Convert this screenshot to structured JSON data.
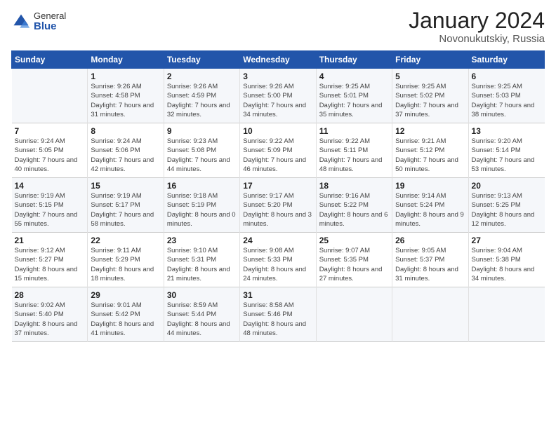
{
  "header": {
    "logo_general": "General",
    "logo_blue": "Blue",
    "month_year": "January 2024",
    "location": "Novonukutskiy, Russia"
  },
  "days_of_week": [
    "Sunday",
    "Monday",
    "Tuesday",
    "Wednesday",
    "Thursday",
    "Friday",
    "Saturday"
  ],
  "weeks": [
    [
      {
        "day": "",
        "sunrise": "",
        "sunset": "",
        "daylight": ""
      },
      {
        "day": "1",
        "sunrise": "Sunrise: 9:26 AM",
        "sunset": "Sunset: 4:58 PM",
        "daylight": "Daylight: 7 hours and 31 minutes."
      },
      {
        "day": "2",
        "sunrise": "Sunrise: 9:26 AM",
        "sunset": "Sunset: 4:59 PM",
        "daylight": "Daylight: 7 hours and 32 minutes."
      },
      {
        "day": "3",
        "sunrise": "Sunrise: 9:26 AM",
        "sunset": "Sunset: 5:00 PM",
        "daylight": "Daylight: 7 hours and 34 minutes."
      },
      {
        "day": "4",
        "sunrise": "Sunrise: 9:25 AM",
        "sunset": "Sunset: 5:01 PM",
        "daylight": "Daylight: 7 hours and 35 minutes."
      },
      {
        "day": "5",
        "sunrise": "Sunrise: 9:25 AM",
        "sunset": "Sunset: 5:02 PM",
        "daylight": "Daylight: 7 hours and 37 minutes."
      },
      {
        "day": "6",
        "sunrise": "Sunrise: 9:25 AM",
        "sunset": "Sunset: 5:03 PM",
        "daylight": "Daylight: 7 hours and 38 minutes."
      }
    ],
    [
      {
        "day": "7",
        "sunrise": "Sunrise: 9:24 AM",
        "sunset": "Sunset: 5:05 PM",
        "daylight": "Daylight: 7 hours and 40 minutes."
      },
      {
        "day": "8",
        "sunrise": "Sunrise: 9:24 AM",
        "sunset": "Sunset: 5:06 PM",
        "daylight": "Daylight: 7 hours and 42 minutes."
      },
      {
        "day": "9",
        "sunrise": "Sunrise: 9:23 AM",
        "sunset": "Sunset: 5:08 PM",
        "daylight": "Daylight: 7 hours and 44 minutes."
      },
      {
        "day": "10",
        "sunrise": "Sunrise: 9:22 AM",
        "sunset": "Sunset: 5:09 PM",
        "daylight": "Daylight: 7 hours and 46 minutes."
      },
      {
        "day": "11",
        "sunrise": "Sunrise: 9:22 AM",
        "sunset": "Sunset: 5:11 PM",
        "daylight": "Daylight: 7 hours and 48 minutes."
      },
      {
        "day": "12",
        "sunrise": "Sunrise: 9:21 AM",
        "sunset": "Sunset: 5:12 PM",
        "daylight": "Daylight: 7 hours and 50 minutes."
      },
      {
        "day": "13",
        "sunrise": "Sunrise: 9:20 AM",
        "sunset": "Sunset: 5:14 PM",
        "daylight": "Daylight: 7 hours and 53 minutes."
      }
    ],
    [
      {
        "day": "14",
        "sunrise": "Sunrise: 9:19 AM",
        "sunset": "Sunset: 5:15 PM",
        "daylight": "Daylight: 7 hours and 55 minutes."
      },
      {
        "day": "15",
        "sunrise": "Sunrise: 9:19 AM",
        "sunset": "Sunset: 5:17 PM",
        "daylight": "Daylight: 7 hours and 58 minutes."
      },
      {
        "day": "16",
        "sunrise": "Sunrise: 9:18 AM",
        "sunset": "Sunset: 5:19 PM",
        "daylight": "Daylight: 8 hours and 0 minutes."
      },
      {
        "day": "17",
        "sunrise": "Sunrise: 9:17 AM",
        "sunset": "Sunset: 5:20 PM",
        "daylight": "Daylight: 8 hours and 3 minutes."
      },
      {
        "day": "18",
        "sunrise": "Sunrise: 9:16 AM",
        "sunset": "Sunset: 5:22 PM",
        "daylight": "Daylight: 8 hours and 6 minutes."
      },
      {
        "day": "19",
        "sunrise": "Sunrise: 9:14 AM",
        "sunset": "Sunset: 5:24 PM",
        "daylight": "Daylight: 8 hours and 9 minutes."
      },
      {
        "day": "20",
        "sunrise": "Sunrise: 9:13 AM",
        "sunset": "Sunset: 5:25 PM",
        "daylight": "Daylight: 8 hours and 12 minutes."
      }
    ],
    [
      {
        "day": "21",
        "sunrise": "Sunrise: 9:12 AM",
        "sunset": "Sunset: 5:27 PM",
        "daylight": "Daylight: 8 hours and 15 minutes."
      },
      {
        "day": "22",
        "sunrise": "Sunrise: 9:11 AM",
        "sunset": "Sunset: 5:29 PM",
        "daylight": "Daylight: 8 hours and 18 minutes."
      },
      {
        "day": "23",
        "sunrise": "Sunrise: 9:10 AM",
        "sunset": "Sunset: 5:31 PM",
        "daylight": "Daylight: 8 hours and 21 minutes."
      },
      {
        "day": "24",
        "sunrise": "Sunrise: 9:08 AM",
        "sunset": "Sunset: 5:33 PM",
        "daylight": "Daylight: 8 hours and 24 minutes."
      },
      {
        "day": "25",
        "sunrise": "Sunrise: 9:07 AM",
        "sunset": "Sunset: 5:35 PM",
        "daylight": "Daylight: 8 hours and 27 minutes."
      },
      {
        "day": "26",
        "sunrise": "Sunrise: 9:05 AM",
        "sunset": "Sunset: 5:37 PM",
        "daylight": "Daylight: 8 hours and 31 minutes."
      },
      {
        "day": "27",
        "sunrise": "Sunrise: 9:04 AM",
        "sunset": "Sunset: 5:38 PM",
        "daylight": "Daylight: 8 hours and 34 minutes."
      }
    ],
    [
      {
        "day": "28",
        "sunrise": "Sunrise: 9:02 AM",
        "sunset": "Sunset: 5:40 PM",
        "daylight": "Daylight: 8 hours and 37 minutes."
      },
      {
        "day": "29",
        "sunrise": "Sunrise: 9:01 AM",
        "sunset": "Sunset: 5:42 PM",
        "daylight": "Daylight: 8 hours and 41 minutes."
      },
      {
        "day": "30",
        "sunrise": "Sunrise: 8:59 AM",
        "sunset": "Sunset: 5:44 PM",
        "daylight": "Daylight: 8 hours and 44 minutes."
      },
      {
        "day": "31",
        "sunrise": "Sunrise: 8:58 AM",
        "sunset": "Sunset: 5:46 PM",
        "daylight": "Daylight: 8 hours and 48 minutes."
      },
      {
        "day": "",
        "sunrise": "",
        "sunset": "",
        "daylight": ""
      },
      {
        "day": "",
        "sunrise": "",
        "sunset": "",
        "daylight": ""
      },
      {
        "day": "",
        "sunrise": "",
        "sunset": "",
        "daylight": ""
      }
    ]
  ]
}
